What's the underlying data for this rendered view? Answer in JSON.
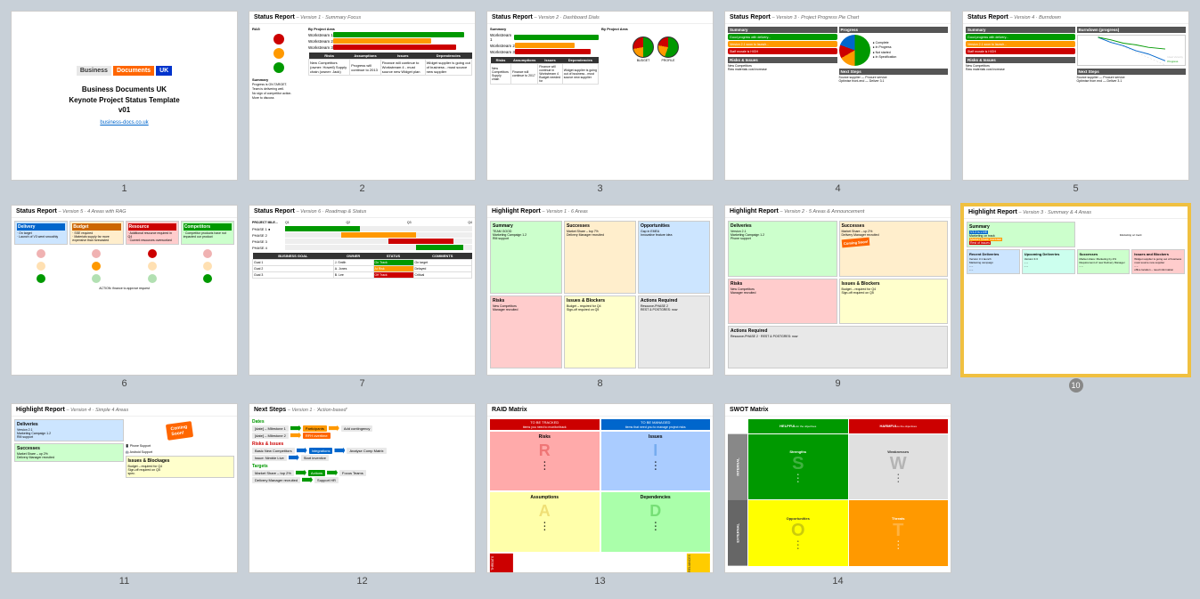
{
  "slides": [
    {
      "id": 1,
      "number": "1",
      "type": "cover",
      "title": "Business Documents UK\nKeynote Project Status Template\nv01",
      "link": "business-docs.co.uk",
      "logo": [
        "Business",
        "Documents",
        "UK"
      ]
    },
    {
      "id": 2,
      "number": "2",
      "type": "status-v1",
      "header": "Status Report",
      "version": "– Version 1 · Summary Focus",
      "sections": [
        "RAG",
        "Summary",
        "By Project Area"
      ],
      "rag": [
        "red",
        "amber",
        "green"
      ],
      "summary_items": [
        "Progress is ON TARGET.",
        "Team is delivering well.",
        "No sign of competitor action.",
        "More to discuss"
      ],
      "bars": [
        [
          "Workstream 1",
          80,
          "green"
        ],
        [
          "Workstream 2",
          60,
          "amber"
        ],
        [
          "Workstream 3",
          90,
          "red"
        ]
      ],
      "table_headers": [
        "Risks",
        "Assumptions",
        "Issues",
        "Dependencies"
      ]
    },
    {
      "id": 3,
      "number": "3",
      "type": "status-v2",
      "header": "Status Report",
      "version": "– Version 2 · Dashboard Dials",
      "sections": [
        "Summary",
        "By Project Area",
        "Risks",
        "Assumptions",
        "Issues",
        "Dependencies"
      ]
    },
    {
      "id": 4,
      "number": "4",
      "type": "status-v3",
      "header": "Status Report",
      "version": "– Version 3 · Project Progress Pie Chart",
      "sections": [
        "Summary",
        "Progress",
        "Risks & Issues",
        "Next Steps"
      ]
    },
    {
      "id": 5,
      "number": "5",
      "type": "status-v4",
      "header": "Status Report",
      "version": "– Version 4 · Burndown",
      "sections": [
        "Summary",
        "Burndown (progress)",
        "Risks & Issues",
        "Next Steps"
      ]
    },
    {
      "id": 6,
      "number": "6",
      "type": "status-v5",
      "header": "Status Report",
      "version": "– Version 5 · 4 Areas with RAG",
      "sections": [
        "Delivery",
        "Budget",
        "Resource",
        "Competitors"
      ]
    },
    {
      "id": 7,
      "number": "7",
      "type": "status-v6",
      "header": "Status Report",
      "version": "– Version 6 · Roadmap & Status",
      "sections": [
        "Roadmap",
        "Status"
      ]
    },
    {
      "id": 8,
      "number": "8",
      "type": "highlight-v1",
      "header": "Highlight Report",
      "version": "– Version 1 · 6 Areas",
      "sections": [
        "Summary",
        "Successes",
        "Opportunities",
        "Risks",
        "Issues & Blockers",
        "Actions Required"
      ]
    },
    {
      "id": 9,
      "number": "9",
      "type": "highlight-v2",
      "header": "Highlight Report",
      "version": "– Version 2 · 5 Areas & Announcement",
      "sections": [
        "Deliveries",
        "Successes",
        "Risks",
        "Issues & Blockers",
        "Actions Required"
      ]
    },
    {
      "id": 10,
      "number": "10",
      "type": "highlight-v3",
      "header": "Highlight Report",
      "version": "– Version 3 · Summary & 4 Areas",
      "sections": [
        "Summary",
        "Recent Deliveries",
        "Upcoming Deliveries",
        "Successes",
        "Issues and Blockers"
      ],
      "selected": true
    },
    {
      "id": 11,
      "number": "11",
      "type": "highlight-v4",
      "header": "Highlight Report",
      "version": "– Version 4 · Simple 4 Areas",
      "sections": [
        "Deliveries",
        "Successes",
        "Issues & Blockages"
      ]
    },
    {
      "id": 12,
      "number": "12",
      "type": "next-steps",
      "header": "Next Steps",
      "version": "– Version 1 · 'Action-based'",
      "sections": [
        "Dates",
        "Risks & Issues",
        "Targets"
      ]
    },
    {
      "id": 13,
      "number": "13",
      "type": "raid",
      "header": "RAID Matrix",
      "version": "",
      "sections": [
        "Risks",
        "Assumptions",
        "Issues",
        "Dependencies"
      ],
      "letters": [
        "R",
        "A",
        "I",
        "D"
      ]
    },
    {
      "id": 14,
      "number": "14",
      "type": "swot",
      "header": "SWOT Matrix",
      "version": "",
      "sections": [
        "Strengths",
        "Weaknesses",
        "Opportunities",
        "Threats"
      ],
      "letters": [
        "S",
        "W",
        "O",
        "T"
      ]
    }
  ]
}
